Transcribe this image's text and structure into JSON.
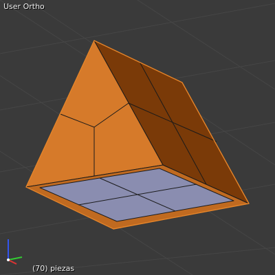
{
  "viewport": {
    "view_label": "User Ortho",
    "object_label": "(70) piezas"
  },
  "scene": {
    "object_name": "piezas",
    "colors": {
      "background": "#3a3a3a",
      "grid": "#454545",
      "face_lit": "#d67a2a",
      "face_shadow": "#7a3a08",
      "base": "#8a8db0",
      "edge": "#1a1a1a",
      "selection_outline": "#e8862a"
    }
  },
  "gizmo": {
    "icons": [
      "x-axis-icon",
      "y-axis-icon",
      "z-axis-icon"
    ],
    "colors": {
      "x": "#dd3333",
      "y": "#33cc33",
      "z": "#3355ee"
    }
  }
}
